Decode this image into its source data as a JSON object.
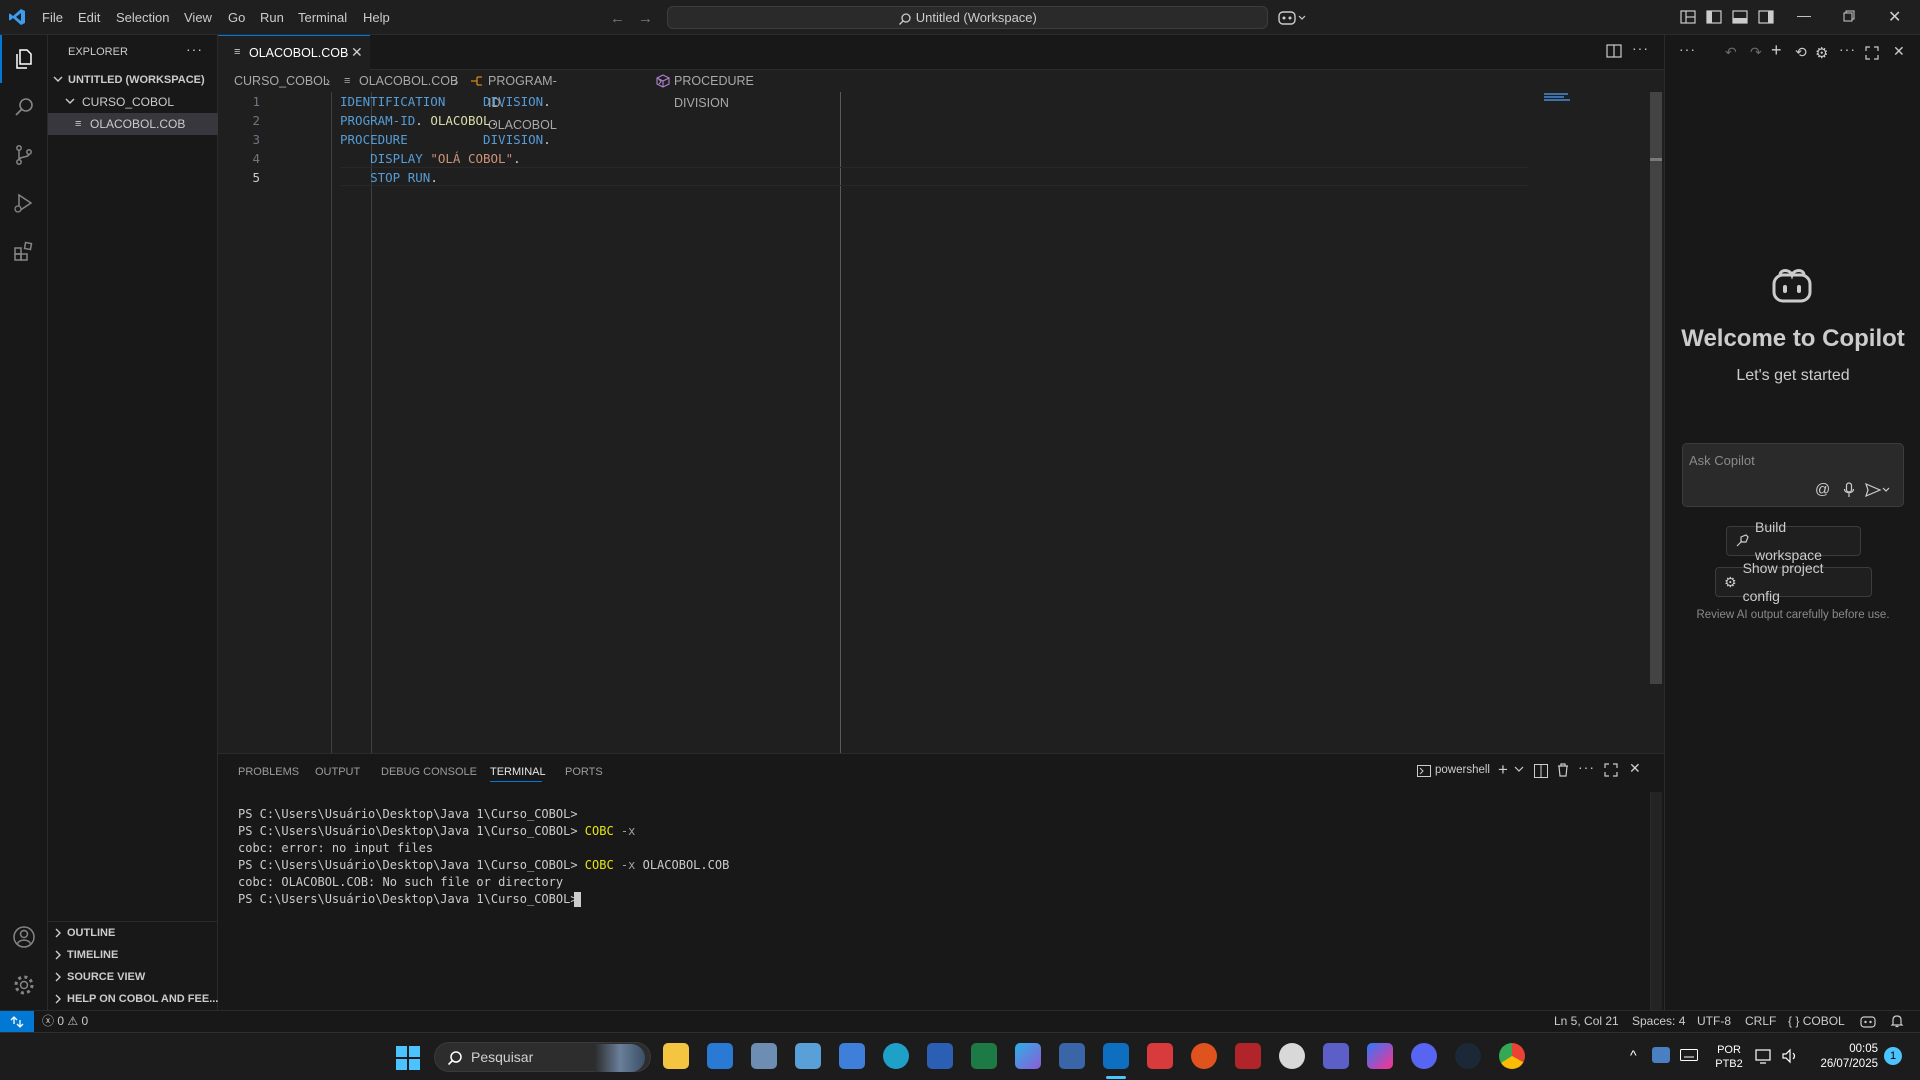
{
  "titlebar": {
    "menu": [
      "File",
      "Edit",
      "Selection",
      "View",
      "Go",
      "Run",
      "Terminal",
      "Help"
    ],
    "search_text": "Untitled (Workspace)"
  },
  "sidebar": {
    "title": "EXPLORER",
    "workspace": "UNTITLED (WORKSPACE)",
    "folder": "CURSO_COBOL",
    "file": "OLACOBOL.COB",
    "sections": [
      "OUTLINE",
      "TIMELINE",
      "SOURCE VIEW",
      "HELP ON COBOL AND FEE..."
    ]
  },
  "editor": {
    "tab_label": "OLACOBOL.COB",
    "breadcrumb": [
      "CURSO_COBOL",
      "OLACOBOL.COB",
      "PROGRAM-ID. OLACOBOL",
      "PROCEDURE DIVISION"
    ],
    "lines": [
      {
        "n": "1",
        "segments": [
          {
            "t": "IDENTIFICATION     DIVISION",
            "c": "kw"
          },
          {
            "t": ".",
            "c": "pn"
          }
        ]
      },
      {
        "n": "2",
        "segments": [
          {
            "t": "PROGRAM-ID",
            "c": "kw"
          },
          {
            "t": ". ",
            "c": "pn"
          },
          {
            "t": "OLACOBOL",
            "c": "id"
          },
          {
            "t": ".",
            "c": "pn"
          }
        ]
      },
      {
        "n": "3",
        "segments": [
          {
            "t": "PROCEDURE          DIVISION",
            "c": "kw"
          },
          {
            "t": ".",
            "c": "pn"
          }
        ]
      },
      {
        "n": "4",
        "segments": [
          {
            "t": "    DISPLAY ",
            "c": "kw"
          },
          {
            "t": "\"OLÁ COBOL\"",
            "c": "str"
          },
          {
            "t": ".",
            "c": "pn"
          }
        ]
      },
      {
        "n": "5",
        "segments": [
          {
            "t": "    STOP RUN",
            "c": "kw"
          },
          {
            "t": ".",
            "c": "pn"
          }
        ]
      }
    ]
  },
  "panel": {
    "tabs": [
      "PROBLEMS",
      "OUTPUT",
      "DEBUG CONSOLE",
      "TERMINAL",
      "PORTS"
    ],
    "active_tab": "TERMINAL",
    "shell": "powershell",
    "terminal_lines": [
      [
        {
          "t": "PS C:\\Users\\Usuário\\Desktop\\Java 1\\Curso_COBOL>",
          "c": ""
        }
      ],
      [
        {
          "t": "PS C:\\Users\\Usuário\\Desktop\\Java 1\\Curso_COBOL> ",
          "c": ""
        },
        {
          "t": "COBC",
          "c": "cmd-y"
        },
        {
          "t": " -x",
          "c": "flag"
        }
      ],
      [
        {
          "t": "cobc: error: no input files",
          "c": ""
        }
      ],
      [
        {
          "t": "PS C:\\Users\\Usuário\\Desktop\\Java 1\\Curso_COBOL> ",
          "c": ""
        },
        {
          "t": "COBC",
          "c": "cmd-y"
        },
        {
          "t": " -x",
          "c": "flag"
        },
        {
          "t": " OLACOBOL.COB",
          "c": ""
        }
      ],
      [
        {
          "t": "cobc: OLACOBOL.COB: No such file or directory",
          "c": ""
        }
      ],
      [
        {
          "t": "PS C:\\Users\\Usuário\\Desktop\\Java 1\\Curso_COBOL> ",
          "c": ""
        }
      ]
    ]
  },
  "copilot": {
    "title": "Welcome to Copilot",
    "subtitle": "Let's get started",
    "input_placeholder": "Ask Copilot",
    "build_button": "Build workspace",
    "config_button": "Show project config",
    "disclaimer": "Review AI output carefully before use."
  },
  "statusbar": {
    "errors": "0",
    "warnings": "0",
    "position": "Ln 5, Col 21",
    "spaces": "Spaces: 4",
    "encoding": "UTF-8",
    "eol": "CRLF",
    "language": "COBOL"
  },
  "taskbar": {
    "search_text": "Pesquisar",
    "lang_top": "POR",
    "lang_bottom": "PTB2",
    "time": "00:05",
    "date": "26/07/2025",
    "notification_count": "1"
  },
  "colors": {
    "accent": "#0078d4",
    "keyword": "#569cd6",
    "identifier": "#dcdcaa",
    "string": "#ce9178"
  }
}
